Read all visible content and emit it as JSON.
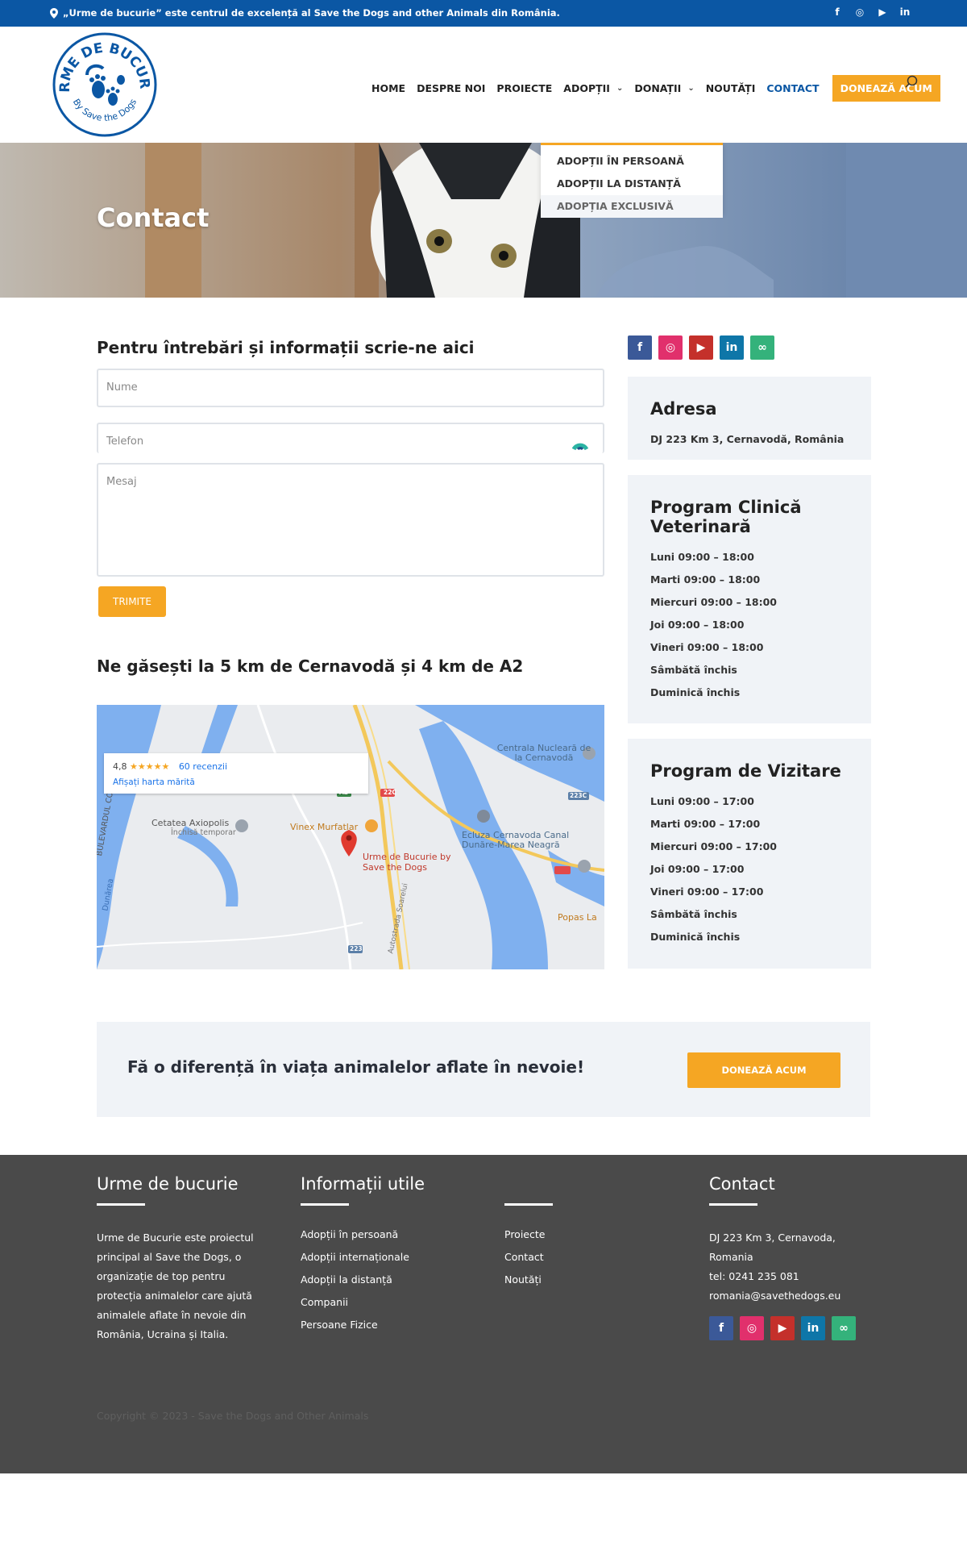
{
  "topbar": {
    "message": "„Urme de bucurie” este centrul de excelență al Save the Dogs and other Animals din România.",
    "socials": [
      "f",
      "◎",
      "▶",
      "in"
    ]
  },
  "logo": {
    "top_text": "URME DE BUCURIE",
    "bottom_text": "By Save the Dogs"
  },
  "nav": {
    "items": [
      {
        "label": "HOME"
      },
      {
        "label": "DESPRE NOI"
      },
      {
        "label": "PROIECTE"
      },
      {
        "label": "ADOPȚII",
        "has_dropdown": true
      },
      {
        "label": "DONAȚII",
        "has_dropdown": true
      },
      {
        "label": "NOUTĂȚI"
      },
      {
        "label": "CONTACT",
        "active": true
      }
    ],
    "donate_label": "DONEAZĂ ACUM"
  },
  "dropdown": {
    "items": [
      "ADOPȚII ÎN PERSOANĂ",
      "ADOPȚII LA DISTANȚĂ",
      "ADOPȚIA EXCLUSIVĂ"
    ]
  },
  "hero": {
    "title": "Contact"
  },
  "form": {
    "title": "Pentru întrebări și informații scrie-ne aici",
    "name_placeholder": "Nume",
    "phone_placeholder": "Telefon",
    "message_placeholder": "Mesaj",
    "submit_label": "Trimite"
  },
  "map": {
    "title": "Ne găsești la 5 km de Cernavodă și 4 km de A2",
    "rating": "4,8",
    "stars": "★★★★★",
    "reviews": "60 recenzii",
    "enlarge_link": "Afișați harta mărită",
    "labels": {
      "centrala": "Centrala Nucleară de la Cernavodă",
      "cetatea": "Cetatea Axiopolis",
      "cetatea_sub": "Închisă temporar",
      "vinex": "Vinex Murfatlar",
      "urme": "Urme de Bucurie by Save the Dogs",
      "ecluza": "Ecluza Cernavoda Canal Dunăre-Marea Neagră",
      "popas": "Popas La",
      "dunarea": "Dunărea",
      "bulevard": "BULEVARDUL CONSTA",
      "road_a2": "A2",
      "road_22c": "22C",
      "road_223c": "223C",
      "road_223": "223",
      "street": "Autostrada Soarelui"
    }
  },
  "sidebar": {
    "socials": [
      {
        "icon": "f",
        "color": "#3b5998"
      },
      {
        "icon": "◎",
        "color": "#e1306c"
      },
      {
        "icon": "▶",
        "color": "#c4302b"
      },
      {
        "icon": "in",
        "color": "#0e76a8"
      },
      {
        "icon": "∞",
        "color": "#34b27b"
      }
    ],
    "address_title": "Adresa",
    "address_line": "DJ 223 Km 3, Cernavodă, România",
    "clinic_title": "Program Clinică Veterinară",
    "clinic_hours": [
      "Luni 09:00 – 18:00",
      "Marti 09:00 – 18:00",
      "Miercuri 09:00 – 18:00",
      "Joi 09:00 – 18:00",
      "Vineri 09:00 – 18:00",
      "Sâmbătă închis",
      "Duminică închis"
    ],
    "visit_title": "Program de Vizitare",
    "visit_hours": [
      "Luni 09:00 – 17:00",
      "Marti 09:00 – 17:00",
      "Miercuri 09:00 – 17:00",
      "Joi 09:00 – 17:00",
      "Vineri 09:00 – 17:00",
      "Sâmbătă închis",
      "Duminică închis"
    ]
  },
  "cta": {
    "text": "Fă o diferență în viața animalelor aflate în nevoie!",
    "button": "DONEAZĂ ACUM"
  },
  "footer": {
    "col1_title": "Urme de bucurie",
    "col1_text": "Urme de Bucurie este proiectul principal al Save the Dogs, o organizație de top pentru protecția animalelor care ajută animalele aflate în nevoie din România, Ucraina și Italia.",
    "col2_title": "Informații utile",
    "col2_links": [
      "Adopții în persoană",
      "Adopții internaționale",
      "Adopții la distanță",
      "Companii",
      "Persoane Fizice"
    ],
    "col3_links": [
      "Proiecte",
      "Contact",
      "Noutăți"
    ],
    "col4_title": "Contact",
    "col4_lines": [
      "DJ 223 Km 3, Cernavoda,",
      "Romania",
      "tel: 0241 235 081",
      "romania@savethedogs.eu"
    ],
    "copyright": "Copyright © 2023 - Save the Dogs and Other Animals"
  }
}
